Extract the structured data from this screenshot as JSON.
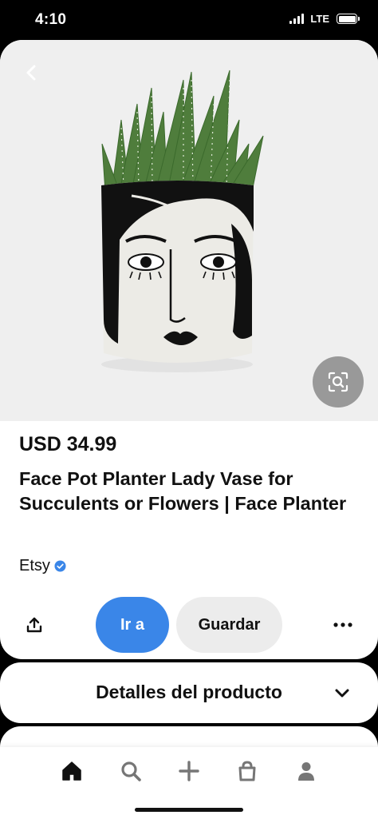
{
  "status_bar": {
    "time": "4:10",
    "network": "LTE"
  },
  "product": {
    "price": "USD 34.99",
    "title": "Face Pot Planter Lady Vase for Succulents or Flowers | Face Planter",
    "merchant": "Etsy",
    "merchant_verified_icon": "verified-check-icon"
  },
  "actions": {
    "visit_label": "Ir a",
    "save_label": "Guardar",
    "share_icon": "share-icon",
    "more_icon": "more-dots-icon"
  },
  "details": {
    "title": "Detalles del producto",
    "chevron_icon": "chevron-down-icon"
  },
  "tab_bar": {
    "items": [
      "home-icon",
      "search-icon",
      "create-icon",
      "shopping-bag-icon",
      "profile-icon"
    ]
  },
  "colors": {
    "primary": "#3a86e8",
    "secondary_button": "#ececec",
    "text": "#111111"
  }
}
